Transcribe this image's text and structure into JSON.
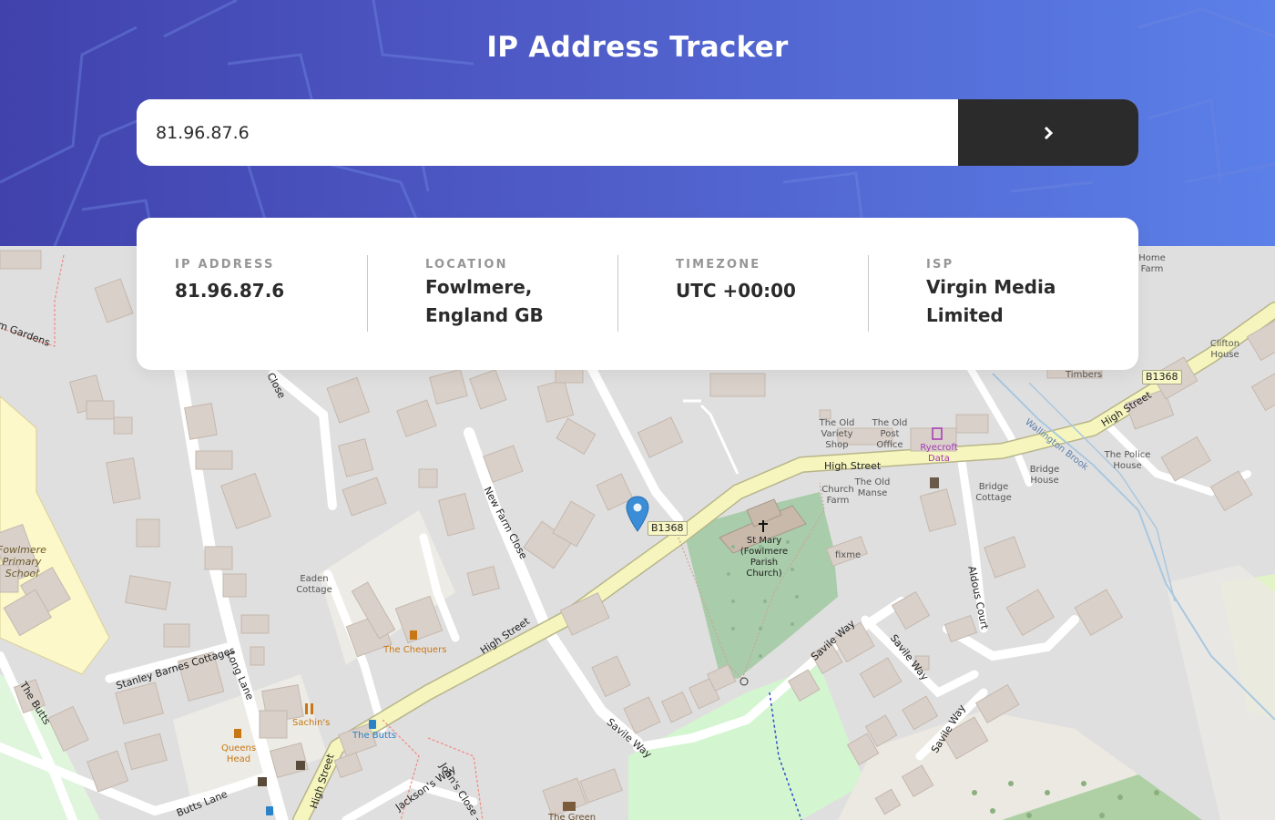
{
  "header": {
    "title": "IP Address Tracker"
  },
  "search": {
    "value": "81.96.87.6",
    "submit_icon": "chevron-right-icon"
  },
  "info": [
    {
      "label": "IP ADDRESS",
      "line1": "81.96.87.6",
      "line2": ""
    },
    {
      "label": "LOCATION",
      "line1": "Fowlmere,",
      "line2": "England GB"
    },
    {
      "label": "TIMEZONE",
      "line1": "UTC +00:00",
      "line2": ""
    },
    {
      "label": "ISP",
      "line1": "Virgin Media",
      "line2": "Limited"
    }
  ],
  "map": {
    "marker_icon": "location-pin-icon",
    "labels": {
      "high_street": "High Street",
      "b1368": "B1368",
      "st_mary_1": "St Mary",
      "st_mary_2": "(Fowlmere",
      "st_mary_3": "Parish",
      "st_mary_4": "Church)",
      "variety_1": "The Old",
      "variety_2": "Variety",
      "variety_3": "Shop",
      "post_1": "The Old",
      "post_2": "Post",
      "post_3": "Office",
      "ryecroft_1": "Ryecroft",
      "ryecroft_2": "Data",
      "church_farm_1": "Church",
      "church_farm_2": "Farm",
      "old_manse_1": "The Old",
      "old_manse_2": "Manse",
      "bridge_house_1": "Bridge",
      "bridge_house_2": "House",
      "bridge_cottage_1": "Bridge",
      "bridge_cottage_2": "Cottage",
      "police_1": "The Police",
      "police_2": "House",
      "timbers": "Timbers",
      "clifton_1": "Clifton",
      "clifton_2": "House",
      "home_farm_1": "Home",
      "home_farm_2": "Farm",
      "fixme": "fixme",
      "eaden_1": "Eaden",
      "eaden_2": "Cottage",
      "chequers": "The Chequers",
      "sachins": "Sachin's",
      "the_butts_bus": "The Butts",
      "queens_1": "Queens",
      "queens_2": "Head",
      "school_1": "Fowlmere",
      "school_2": "Primary",
      "school_3": "School",
      "new_farm_close": "New Farm Close",
      "stanley_barnes": "Stanley Barnes Cottages",
      "long_lane": "Long Lane",
      "the_butts_road": "The Butts",
      "butts_lane": "Butts Lane",
      "jacksons_way": "Jackson's Way",
      "johns_close": "John's Close - Hi",
      "savile_way": "Savile Way",
      "aldous_court": "Aldous Court",
      "wallington_brook": "Wallington Brook",
      "close": "Close",
      "gardens": "m Gardens",
      "the_green": "The Green"
    }
  }
}
